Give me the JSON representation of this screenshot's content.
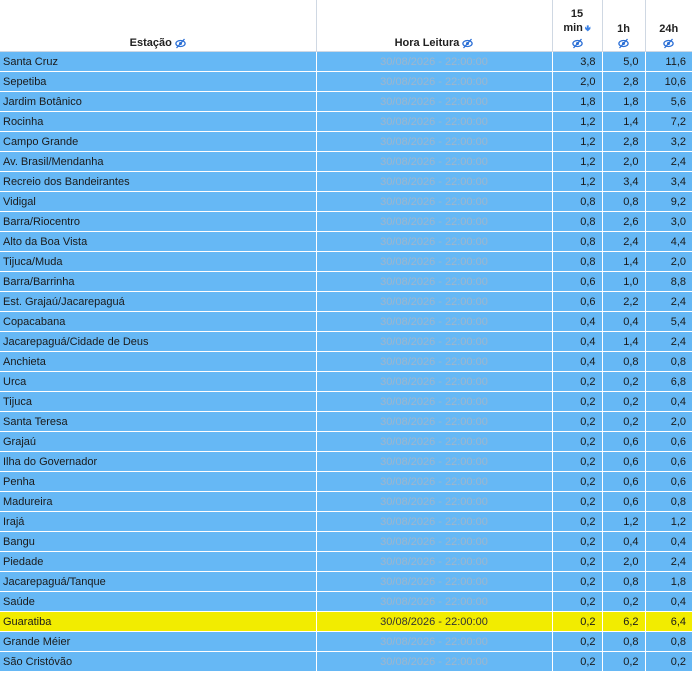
{
  "header": {
    "station": "Estação",
    "time": "Hora Leitura",
    "min15_top": "15",
    "min15_bottom": "min",
    "h1": "1h",
    "h24": "24h"
  },
  "icons": {
    "eye": "eye-slash-icon",
    "sort": "sort-down-icon"
  },
  "colors": {
    "row_bg": "#66b8f5",
    "highlight_bg": "#f2ec00",
    "time_text": "#9fb6cc"
  },
  "rows": [
    {
      "station": "Santa Cruz",
      "time": "30/08/2026 - 22:00:00",
      "m15": "3,8",
      "h1": "5,0",
      "h24": "11,6"
    },
    {
      "station": "Sepetiba",
      "time": "30/08/2026 - 22:00:00",
      "m15": "2,0",
      "h1": "2,8",
      "h24": "10,6"
    },
    {
      "station": "Jardim Botânico",
      "time": "30/08/2026 - 22:00:00",
      "m15": "1,8",
      "h1": "1,8",
      "h24": "5,6"
    },
    {
      "station": "Rocinha",
      "time": "30/08/2026 - 22:00:00",
      "m15": "1,2",
      "h1": "1,4",
      "h24": "7,2"
    },
    {
      "station": "Campo Grande",
      "time": "30/08/2026 - 22:00:00",
      "m15": "1,2",
      "h1": "2,8",
      "h24": "3,2"
    },
    {
      "station": "Av. Brasil/Mendanha",
      "time": "30/08/2026 - 22:00:00",
      "m15": "1,2",
      "h1": "2,0",
      "h24": "2,4"
    },
    {
      "station": "Recreio dos Bandeirantes",
      "time": "30/08/2026 - 22:00:00",
      "m15": "1,2",
      "h1": "3,4",
      "h24": "3,4"
    },
    {
      "station": "Vidigal",
      "time": "30/08/2026 - 22:00:00",
      "m15": "0,8",
      "h1": "0,8",
      "h24": "9,2"
    },
    {
      "station": "Barra/Riocentro",
      "time": "30/08/2026 - 22:00:00",
      "m15": "0,8",
      "h1": "2,6",
      "h24": "3,0"
    },
    {
      "station": "Alto da Boa Vista",
      "time": "30/08/2026 - 22:00:00",
      "m15": "0,8",
      "h1": "2,4",
      "h24": "4,4"
    },
    {
      "station": "Tijuca/Muda",
      "time": "30/08/2026 - 22:00:00",
      "m15": "0,8",
      "h1": "1,4",
      "h24": "2,0"
    },
    {
      "station": "Barra/Barrinha",
      "time": "30/08/2026 - 22:00:00",
      "m15": "0,6",
      "h1": "1,0",
      "h24": "8,8"
    },
    {
      "station": "Est. Grajaú/Jacarepaguá",
      "time": "30/08/2026 - 22:00:00",
      "m15": "0,6",
      "h1": "2,2",
      "h24": "2,4"
    },
    {
      "station": "Copacabana",
      "time": "30/08/2026 - 22:00:00",
      "m15": "0,4",
      "h1": "0,4",
      "h24": "5,4"
    },
    {
      "station": "Jacarepaguá/Cidade de Deus",
      "time": "30/08/2026 - 22:00:00",
      "m15": "0,4",
      "h1": "1,4",
      "h24": "2,4"
    },
    {
      "station": "Anchieta",
      "time": "30/08/2026 - 22:00:00",
      "m15": "0,4",
      "h1": "0,8",
      "h24": "0,8"
    },
    {
      "station": "Urca",
      "time": "30/08/2026 - 22:00:00",
      "m15": "0,2",
      "h1": "0,2",
      "h24": "6,8"
    },
    {
      "station": "Tijuca",
      "time": "30/08/2026 - 22:00:00",
      "m15": "0,2",
      "h1": "0,2",
      "h24": "0,4"
    },
    {
      "station": "Santa Teresa",
      "time": "30/08/2026 - 22:00:00",
      "m15": "0,2",
      "h1": "0,2",
      "h24": "2,0"
    },
    {
      "station": "Grajaú",
      "time": "30/08/2026 - 22:00:00",
      "m15": "0,2",
      "h1": "0,6",
      "h24": "0,6"
    },
    {
      "station": "Ilha do Governador",
      "time": "30/08/2026 - 22:00:00",
      "m15": "0,2",
      "h1": "0,6",
      "h24": "0,6"
    },
    {
      "station": "Penha",
      "time": "30/08/2026 - 22:00:00",
      "m15": "0,2",
      "h1": "0,6",
      "h24": "0,6"
    },
    {
      "station": "Madureira",
      "time": "30/08/2026 - 22:00:00",
      "m15": "0,2",
      "h1": "0,6",
      "h24": "0,8"
    },
    {
      "station": "Irajá",
      "time": "30/08/2026 - 22:00:00",
      "m15": "0,2",
      "h1": "1,2",
      "h24": "1,2"
    },
    {
      "station": "Bangu",
      "time": "30/08/2026 - 22:00:00",
      "m15": "0,2",
      "h1": "0,4",
      "h24": "0,4"
    },
    {
      "station": "Piedade",
      "time": "30/08/2026 - 22:00:00",
      "m15": "0,2",
      "h1": "2,0",
      "h24": "2,4"
    },
    {
      "station": "Jacarepaguá/Tanque",
      "time": "30/08/2026 - 22:00:00",
      "m15": "0,2",
      "h1": "0,8",
      "h24": "1,8"
    },
    {
      "station": "Saúde",
      "time": "30/08/2026 - 22:00:00",
      "m15": "0,2",
      "h1": "0,2",
      "h24": "0,4"
    },
    {
      "station": "Guaratiba",
      "time": "30/08/2026 - 22:00:00",
      "m15": "0,2",
      "h1": "6,2",
      "h24": "6,4",
      "highlight": true
    },
    {
      "station": "Grande Méier",
      "time": "30/08/2026 - 22:00:00",
      "m15": "0,2",
      "h1": "0,8",
      "h24": "0,8"
    },
    {
      "station": "São Cristóvão",
      "time": "30/08/2026 - 22:00:00",
      "m15": "0,2",
      "h1": "0,2",
      "h24": "0,2"
    }
  ]
}
